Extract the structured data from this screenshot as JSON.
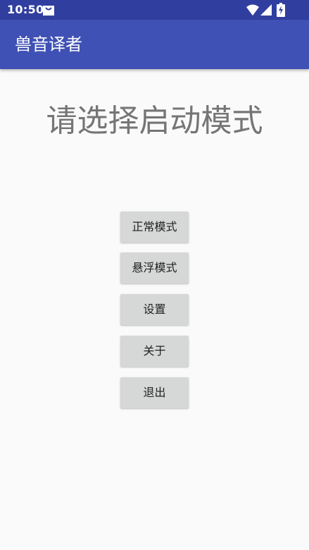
{
  "status_bar": {
    "time": "10:50",
    "icons": [
      "notification-bag-icon",
      "wifi-icon",
      "signal-icon",
      "battery-charging-icon"
    ],
    "color": "#303f9f"
  },
  "app_bar": {
    "title": "兽音译者",
    "color": "#3f51b5"
  },
  "main": {
    "heading": "请选择启动模式",
    "buttons": [
      {
        "label": "正常模式"
      },
      {
        "label": "悬浮模式"
      },
      {
        "label": "设置"
      },
      {
        "label": "关于"
      },
      {
        "label": "退出"
      }
    ]
  }
}
